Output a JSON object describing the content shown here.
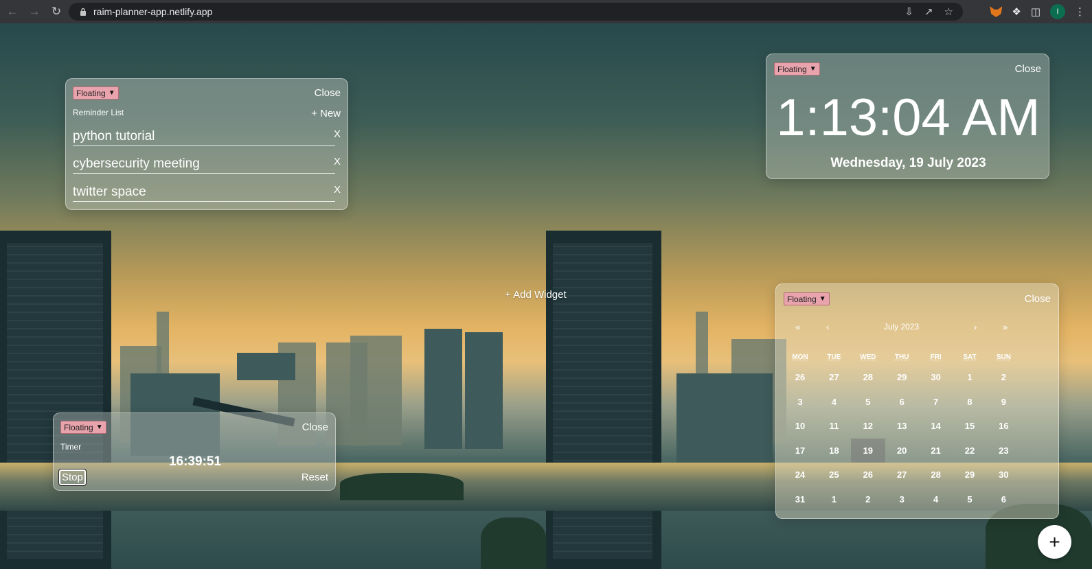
{
  "browser": {
    "url": "raim-planner-app.netlify.app",
    "profile_initial": "I",
    "back_icon": "arrow-left-icon",
    "forward_icon": "arrow-right-icon",
    "reload_icon": "reload-icon",
    "lock_icon": "lock-icon"
  },
  "add_widget_label": "+ Add Widget",
  "reminder": {
    "mode": "Floating",
    "close_label": "Close",
    "title": "Reminder List",
    "new_label": "+ New",
    "items": [
      {
        "text": "python tutorial",
        "remove": "X"
      },
      {
        "text": "cybersecurity meeting",
        "remove": "X"
      },
      {
        "text": "twitter space",
        "remove": "X"
      }
    ]
  },
  "clock": {
    "mode": "Floating",
    "close_label": "Close",
    "time": "1:13:04 AM",
    "date": "Wednesday, 19 July 2023"
  },
  "timer": {
    "mode": "Floating",
    "close_label": "Close",
    "title": "Timer",
    "elapsed": "16:39:51",
    "stop_label": "Stop",
    "reset_label": "Reset"
  },
  "calendar": {
    "mode": "Floating",
    "close_label": "Close",
    "month_label": "July 2023",
    "prev_year": "«",
    "prev_month": "‹",
    "next_month": "›",
    "next_year": "»",
    "weekdays": [
      "MON",
      "TUE",
      "WED",
      "THU",
      "FRI",
      "SAT",
      "SUN"
    ],
    "weeks": [
      [
        "26",
        "27",
        "28",
        "29",
        "30",
        "1",
        "2"
      ],
      [
        "3",
        "4",
        "5",
        "6",
        "7",
        "8",
        "9"
      ],
      [
        "10",
        "11",
        "12",
        "13",
        "14",
        "15",
        "16"
      ],
      [
        "17",
        "18",
        "19",
        "20",
        "21",
        "22",
        "23"
      ],
      [
        "24",
        "25",
        "26",
        "27",
        "28",
        "29",
        "30"
      ],
      [
        "31",
        "1",
        "2",
        "3",
        "4",
        "5",
        "6"
      ]
    ],
    "selected_day": "19"
  },
  "fab_label": "+"
}
